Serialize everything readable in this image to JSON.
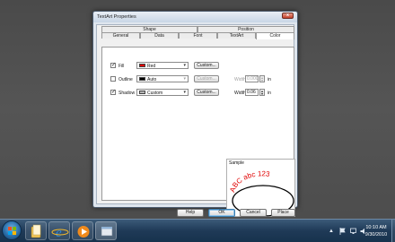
{
  "dialog": {
    "title": "TextArt Properties",
    "close_glyph": "x",
    "tabs_top": [
      {
        "label": "Shape"
      },
      {
        "label": "Position"
      }
    ],
    "tabs_bottom": [
      {
        "label": "General"
      },
      {
        "label": "Data"
      },
      {
        "label": "Font"
      },
      {
        "label": "TextArt"
      },
      {
        "label": "Color",
        "active": true
      }
    ],
    "rows": {
      "fill": {
        "label": "Fill",
        "checked": true,
        "check_glyph": "✓",
        "color_name": "Red",
        "swatch": "#e00000",
        "button": "Custom..."
      },
      "outline": {
        "label": "Outline",
        "checked": false,
        "color_name": "Auto",
        "swatch": "#000000",
        "button": "Custom...",
        "width_label": "Width",
        "width_value": "0.000",
        "unit": "in"
      },
      "shadow": {
        "label": "Shadow",
        "checked": true,
        "check_glyph": "✓",
        "color_name": "Custom",
        "swatch": "#b4b4b4",
        "button": "Custom...",
        "width_label": "Width",
        "width_value": "0.06",
        "unit": "in"
      }
    },
    "sample": {
      "label": "Sample",
      "text": "ABC abc 123",
      "text_color": "#e00000"
    },
    "buttons": {
      "help": "Help",
      "ok": "OK",
      "cancel": "Cancel",
      "place": "Place"
    }
  },
  "taskbar": {
    "time": "10:10 AM",
    "date": "9/30/2010"
  }
}
